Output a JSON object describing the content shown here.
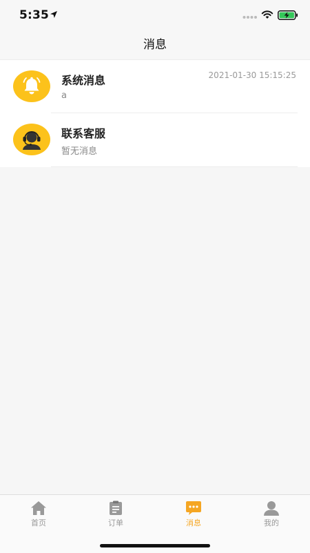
{
  "status_bar": {
    "time": "5:35",
    "icons": [
      "location-arrow-icon",
      "cellular-signal-icon",
      "wifi-icon",
      "battery-charging-icon"
    ]
  },
  "nav": {
    "title": "消息"
  },
  "messages": [
    {
      "title": "系统消息",
      "preview": "a",
      "time": "2021-01-30 15:15:25",
      "icon": "bell-icon"
    },
    {
      "title": "联系客服",
      "preview": "暂无消息",
      "icon": "headset-agent-icon"
    }
  ],
  "tabs": [
    {
      "label": "首页",
      "icon": "home-icon",
      "active": false
    },
    {
      "label": "订单",
      "icon": "clipboard-icon",
      "active": false
    },
    {
      "label": "消息",
      "icon": "chat-bubble-icon",
      "active": true
    },
    {
      "label": "我的",
      "icon": "user-icon",
      "active": false
    }
  ],
  "colors": {
    "accent": "#f5a623",
    "avatar_yellow": "#fcc21b",
    "inactive": "#999999",
    "background": "#f6f6f6"
  }
}
